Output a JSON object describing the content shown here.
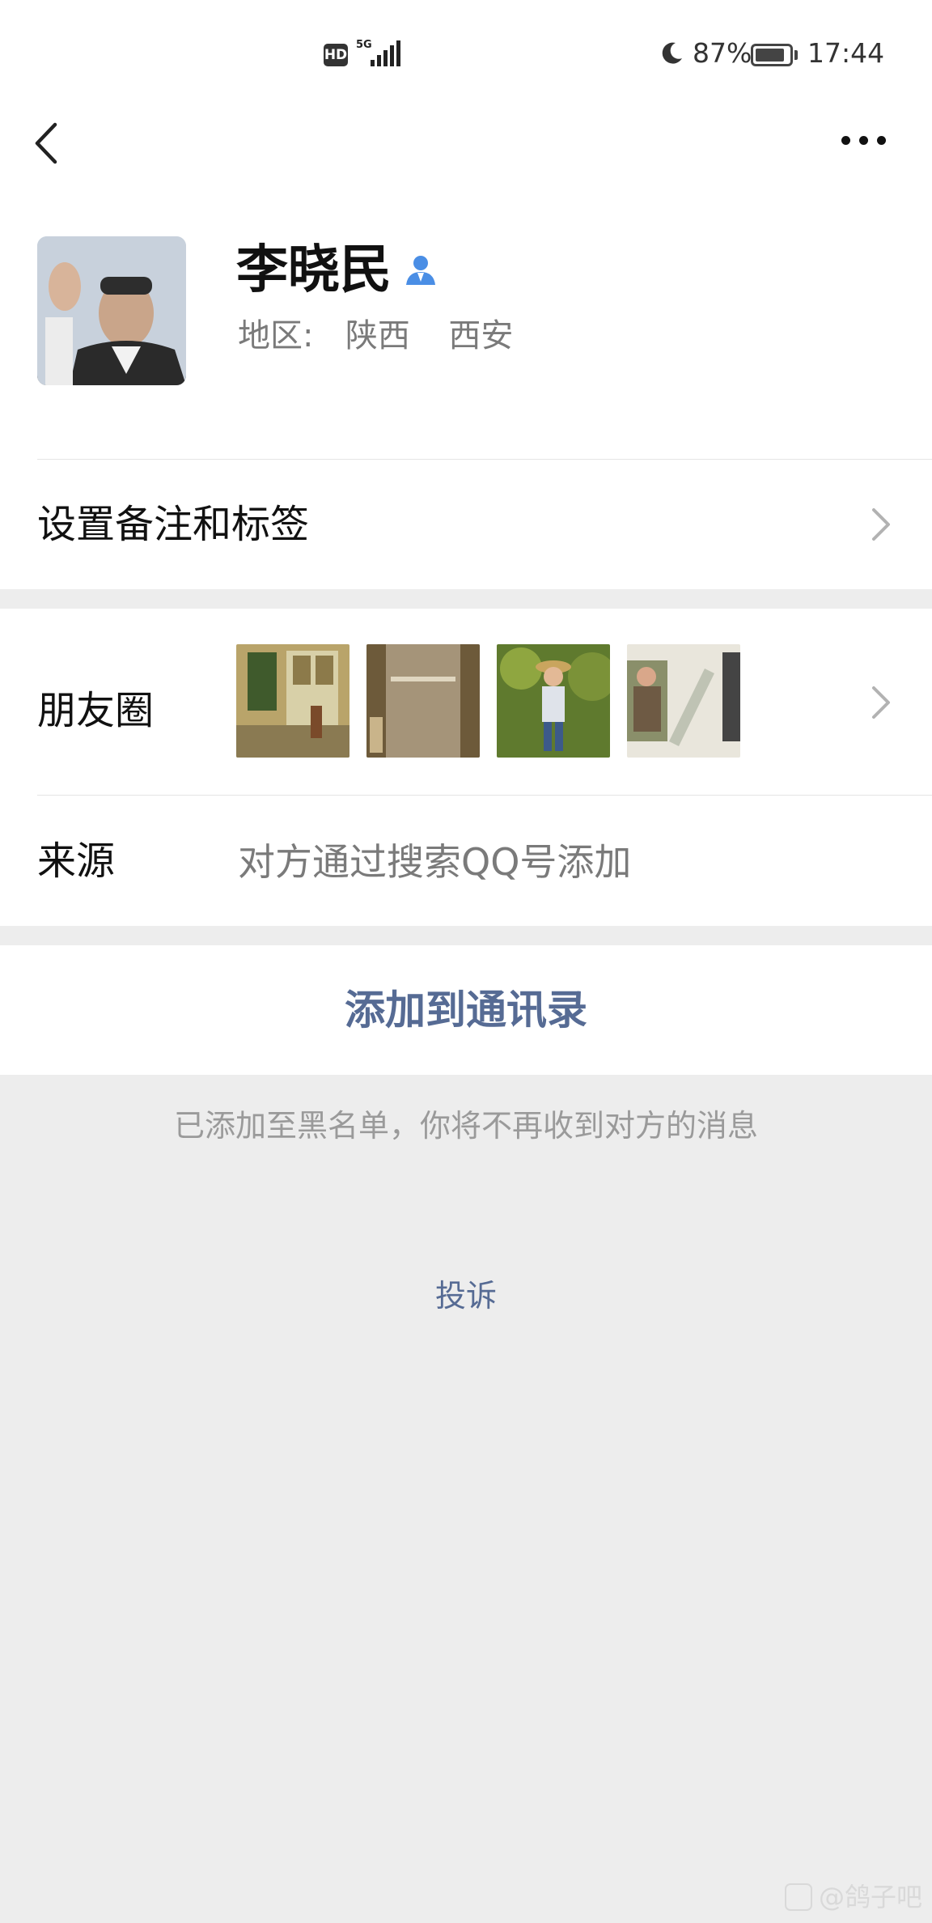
{
  "status_bar": {
    "hd": "HD",
    "network": "5G",
    "battery": "87%",
    "battery_level": 0.87,
    "time": "17:44"
  },
  "nav": {
    "back_icon": "chevron-left-icon",
    "more_icon": "more-dots-icon"
  },
  "profile": {
    "name": "李晓民",
    "region_label": "地区:",
    "province": "陕西",
    "city": "西安",
    "contact_icon": "person-icon"
  },
  "rows": {
    "remark": {
      "label": "设置备注和标签"
    },
    "moments": {
      "label": "朋友圈"
    },
    "source": {
      "label": "来源",
      "value": "对方通过搜索QQ号添加"
    }
  },
  "actions": {
    "add_contact": "添加到通讯录",
    "blocked_notice": "已添加至黑名单，你将不再收到对方的消息",
    "report": "投诉"
  },
  "watermark": {
    "text": "@鸽子吧"
  },
  "colors": {
    "link": "#566b94",
    "background": "#ededed",
    "card": "#ffffff",
    "verified_icon": "#4a8ee5"
  }
}
